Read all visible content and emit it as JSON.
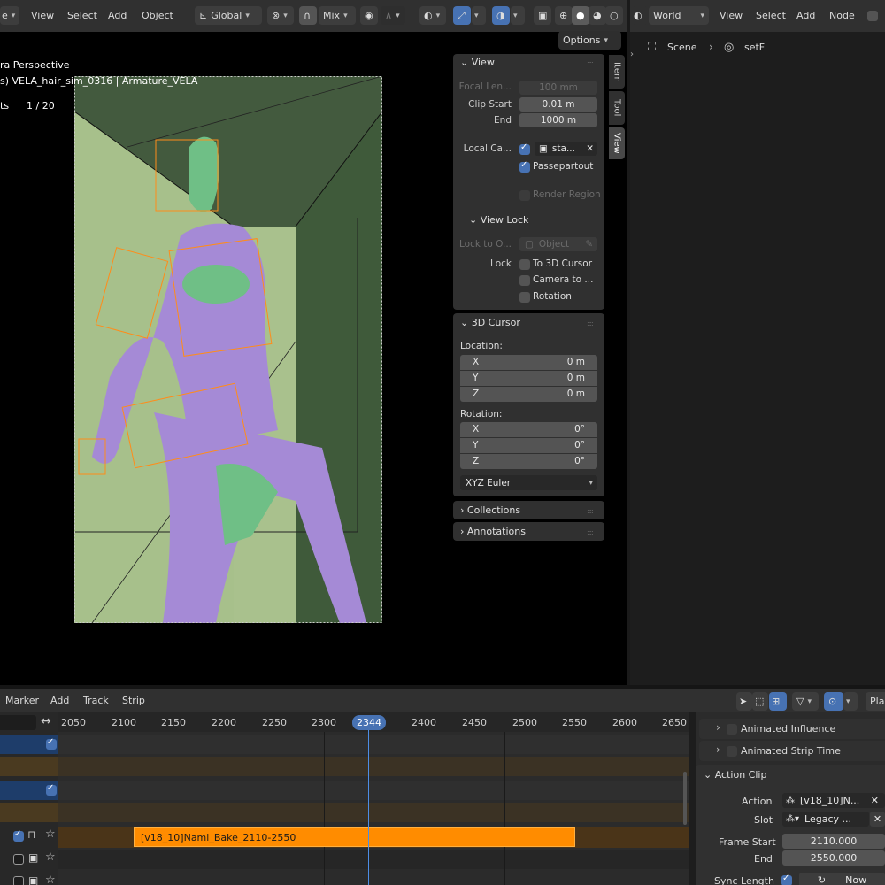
{
  "topbar": {
    "edge_label": "e",
    "menus": [
      "View",
      "Select",
      "Add",
      "Object"
    ],
    "orientation": "Global",
    "snap_mode": "Mix",
    "right_editor": "World",
    "right_menus": [
      "View",
      "Select",
      "Add",
      "Node"
    ]
  },
  "viewport": {
    "options_label": "Options",
    "hud_line1": "ra Perspective",
    "hud_line2": "s) VELA_hair_sim_0316 | Armature_VELA",
    "hud_line3_label": "ts",
    "hud_line3_value": "1 / 20"
  },
  "sidebar_tabs": [
    "Item",
    "Tool",
    "View"
  ],
  "view_panel": {
    "title": "View",
    "focal_label": "Focal Len...",
    "focal_value": "100 mm",
    "clip_start_label": "Clip Start",
    "clip_start_value": "0.01 m",
    "end_label": "End",
    "end_value": "1000 m",
    "local_camera_label": "Local Ca...",
    "local_camera_value": "sta...",
    "passepartout_label": "Passepartout",
    "render_region_label": "Render Region",
    "view_lock_title": "View Lock",
    "lock_to_label": "Lock to O...",
    "lock_to_placeholder": "Object",
    "lock_label": "Lock",
    "to_3d_cursor_label": "To 3D Cursor",
    "camera_to_label": "Camera to ...",
    "rotation_label": "Rotation"
  },
  "cursor_panel": {
    "title": "3D Cursor",
    "location_label": "Location:",
    "location": [
      {
        "axis": "X",
        "value": "0 m"
      },
      {
        "axis": "Y",
        "value": "0 m"
      },
      {
        "axis": "Z",
        "value": "0 m"
      }
    ],
    "rotation_label": "Rotation:",
    "rotation": [
      {
        "axis": "X",
        "value": "0°"
      },
      {
        "axis": "Y",
        "value": "0°"
      },
      {
        "axis": "Z",
        "value": "0°"
      }
    ],
    "rotation_mode": "XYZ Euler"
  },
  "collections_label": "Collections",
  "annotations_label": "Annotations",
  "node_editor": {
    "breadcrumb_scene": "Scene",
    "breadcrumb_world": "setF"
  },
  "nla": {
    "menus": [
      "Marker",
      "Add",
      "Track",
      "Strip"
    ],
    "current_frame": "2344",
    "ticks": [
      "2050",
      "2100",
      "2150",
      "2200",
      "2250",
      "2300",
      "2400",
      "2450",
      "2500",
      "2550",
      "2600",
      "2650"
    ],
    "strip_label": "[v18_10]Nami_Bake_2110-2550",
    "playback_label": "Pla"
  },
  "strip_props": {
    "animated_influence": "Animated Influence",
    "animated_strip_time": "Animated Strip Time",
    "action_clip_title": "Action Clip",
    "action_label": "Action",
    "action_value": "[v18_10]N...",
    "slot_label": "Slot",
    "slot_value": "Legacy ...",
    "frame_start_label": "Frame Start",
    "frame_start_value": "2110.000",
    "end_label": "End",
    "end_value": "2550.000",
    "sync_length_label": "Sync Length",
    "now_label": "Now"
  },
  "colors": {
    "accent": "#4772b3",
    "strip": "#ff8c00",
    "playhead": "#4d8ee6"
  }
}
